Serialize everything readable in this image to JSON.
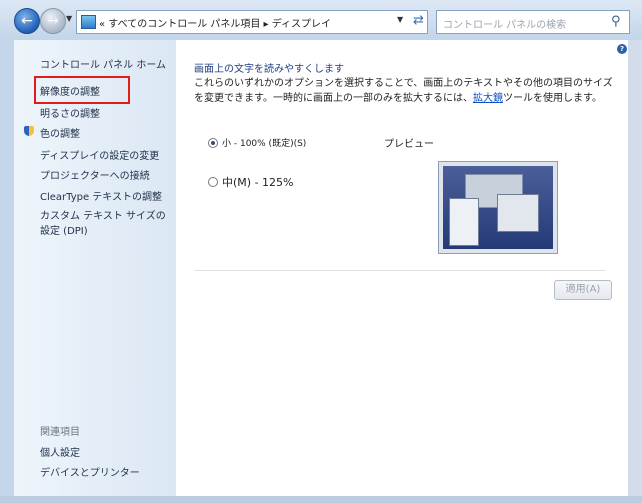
{
  "nav": {
    "back_icon": "back-arrow",
    "forward_icon": "forward-arrow",
    "breadcrumb": "« すべてのコントロール パネル項目 ▸ ディスプレイ",
    "search_placeholder": "コントロール パネルの検索"
  },
  "sidebar": {
    "home": "コントロール パネル ホーム",
    "items": [
      {
        "label": "解像度の調整"
      },
      {
        "label": "明るさの調整"
      },
      {
        "label": "色の調整"
      },
      {
        "label": "ディスプレイの設定の変更"
      },
      {
        "label": "プロジェクターへの接続"
      },
      {
        "label": "ClearType テキストの調整"
      },
      {
        "label": "カスタム テキスト サイズの設定 (DPI)"
      }
    ],
    "related_heading": "関連項目",
    "related": [
      {
        "label": "個人設定"
      },
      {
        "label": "デバイスとプリンター"
      }
    ]
  },
  "main": {
    "heading": "画面上の文字を読みやすくします",
    "desc_part1": "これらのいずれかのオプションを選択することで、画面上のテキストやその他の項目のサイズを変更できます。一時的に画面上の一部のみを拡大するには、",
    "desc_link": "拡大鏡",
    "desc_part2": "ツールを使用します。",
    "option_small": "小 - 100% (既定)(S)",
    "option_medium": "中(M) - 125%",
    "selected": "small",
    "preview_label": "プレビュー",
    "apply": "適用(A)"
  },
  "colors": {
    "highlight": "#e41b1b",
    "link": "#0b4ec8"
  }
}
